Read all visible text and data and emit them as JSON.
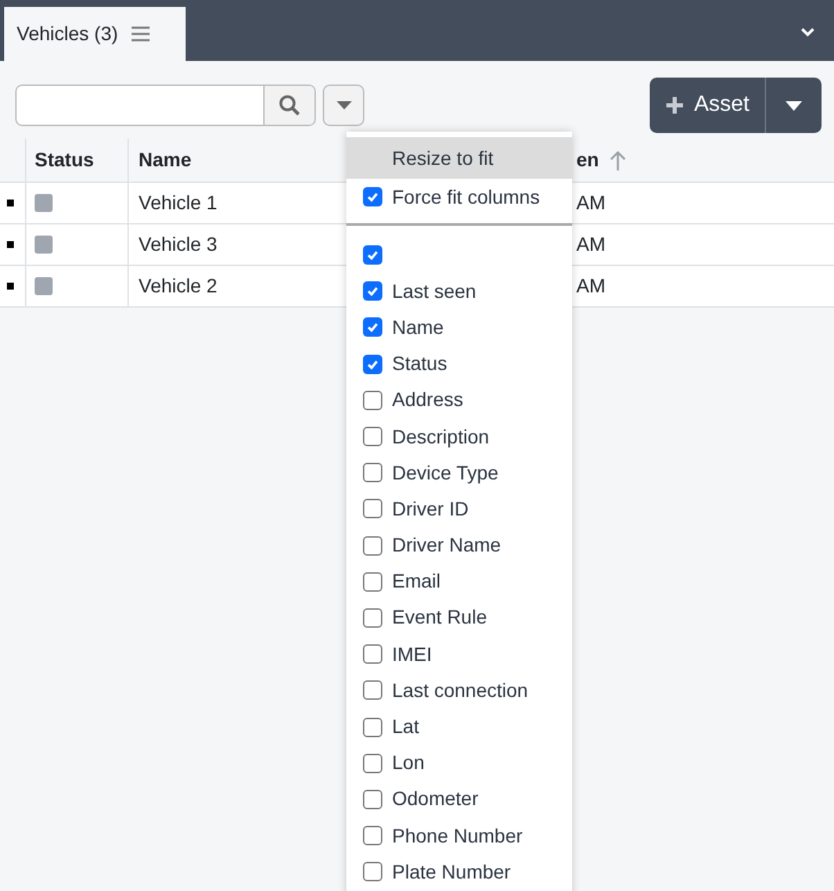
{
  "tab": {
    "label": "Vehicles (3)"
  },
  "asset_button": {
    "label": "Asset"
  },
  "table": {
    "columns": [
      "Status",
      "Name",
      "en"
    ],
    "rows": [
      {
        "name": "Vehicle 1",
        "column_3": "AM"
      },
      {
        "name": "Vehicle 3",
        "column_3": "AM"
      },
      {
        "name": "Vehicle 2",
        "column_3": "AM"
      }
    ]
  },
  "column_menu": {
    "resize": "Resize to fit",
    "force_fit": {
      "label": "Force fit columns",
      "checked": true
    },
    "columns": [
      {
        "checked": true
      },
      {
        "label": "Last seen",
        "checked": true
      },
      {
        "label": "Name",
        "checked": true
      },
      {
        "label": "Status",
        "checked": true
      },
      {
        "label": "Address",
        "checked": false
      },
      {
        "label": "Description",
        "checked": false
      },
      {
        "label": "Device Type",
        "checked": false
      },
      {
        "label": "Driver ID",
        "checked": false
      },
      {
        "label": "Driver Name",
        "checked": false
      },
      {
        "label": "Email",
        "checked": false
      },
      {
        "label": "Event Rule",
        "checked": false
      },
      {
        "label": "IMEI",
        "checked": false
      },
      {
        "label": "Last connection",
        "checked": false
      },
      {
        "label": "Lat",
        "checked": false
      },
      {
        "label": "Lon",
        "checked": false
      },
      {
        "label": "Odometer",
        "checked": false
      },
      {
        "label": "Phone Number",
        "checked": false
      },
      {
        "label": "Plate Number",
        "checked": false
      }
    ]
  }
}
